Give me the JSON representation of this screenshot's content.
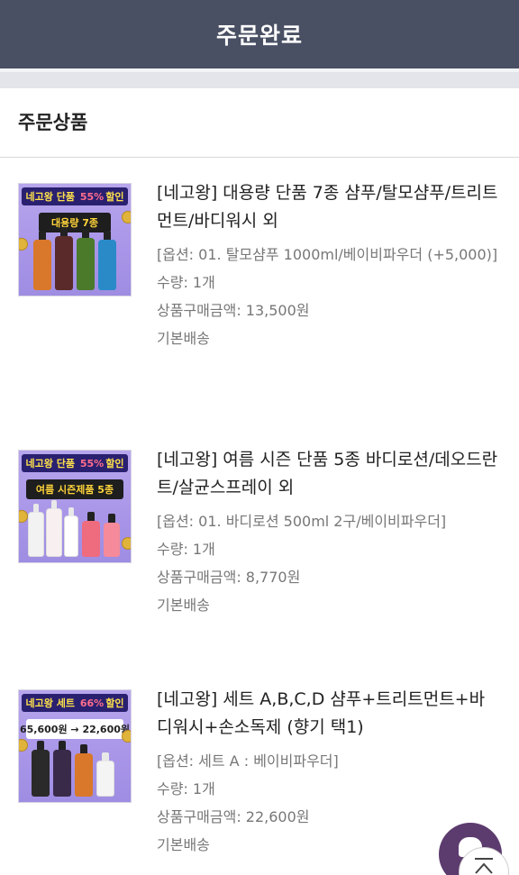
{
  "header": {
    "title": "주문완료"
  },
  "section": {
    "title": "주문상품"
  },
  "products": [
    {
      "thumb_badge_brand": "네고왕",
      "thumb_badge_type": "단품",
      "thumb_badge_pct": "55%",
      "thumb_badge_sale": "할인",
      "thumb_sub": "대용량 7종",
      "name": "[네고왕] 대용량 단품 7종 샴푸/탈모샴푸/트리트먼트/바디워시 외",
      "option": "[옵션: 01. 탈모샴푸 1000ml/베이비파우더 (+5,000)]",
      "quantity": "수량: 1개",
      "price": "상품구매금액: 13,500원",
      "shipping": "기본배송"
    },
    {
      "thumb_badge_brand": "네고왕",
      "thumb_badge_type": "단품",
      "thumb_badge_pct": "55%",
      "thumb_badge_sale": "할인",
      "thumb_sub": "여름 시즌제품 5종",
      "name": "[네고왕] 여름 시즌 단품 5종 바디로션/데오드란트/살균스프레이 외",
      "option": "[옵션: 01. 바디로션 500ml 2구/베이비파우더]",
      "quantity": "수량: 1개",
      "price": "상품구매금액: 8,770원",
      "shipping": "기본배송"
    },
    {
      "thumb_badge_brand": "네고왕",
      "thumb_badge_type": "세트",
      "thumb_badge_pct": "66%",
      "thumb_badge_sale": "할인",
      "thumb_sub": "65,600원 → 22,600원",
      "name": "[네고왕] 세트 A,B,C,D 샴푸+트리트먼트+바디워시+손소독제 (향기 택1)",
      "option": "[옵션: 세트 A : 베이비파우더]",
      "quantity": "수량: 1개",
      "price": "상품구매금액: 22,600원",
      "shipping": "기본배송"
    }
  ],
  "icons": {
    "chat": "chat-bubble-icon",
    "scroll_top": "arrow-up-icon"
  },
  "colors": {
    "header_bg": "#4a5063",
    "fab_bg": "#5c3b6e"
  }
}
